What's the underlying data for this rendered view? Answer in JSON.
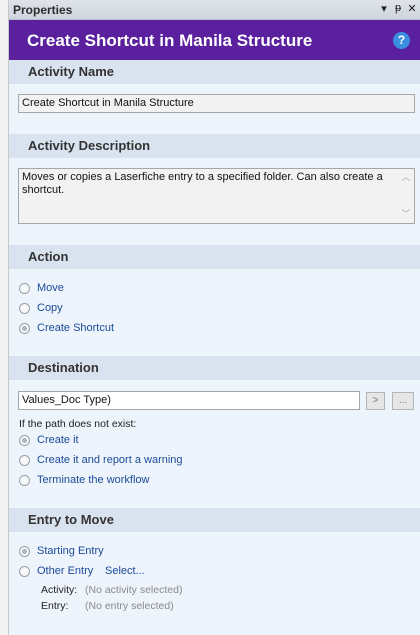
{
  "window": {
    "title": "Properties",
    "ctrl_dropdown": "▾",
    "ctrl_pin": "ᵽ",
    "ctrl_close": "✕"
  },
  "header": {
    "title": "Create Shortcut in Manila Structure",
    "help": "?"
  },
  "activity_name": {
    "heading": "Activity Name",
    "value": "Create Shortcut in Manila Structure"
  },
  "activity_description": {
    "heading": "Activity Description",
    "value": "Moves or copies a Laserfiche entry to a specified folder.  Can also create a shortcut."
  },
  "action": {
    "heading": "Action",
    "options": [
      "Move",
      "Copy",
      "Create Shortcut"
    ],
    "selected": "Create Shortcut"
  },
  "destination": {
    "heading": "Destination",
    "path_value": "Values_Doc Type)",
    "browse_label": ">",
    "more_label": "...",
    "if_not_exist_label": "If the path does not exist:",
    "options": [
      "Create it",
      "Create it and report a warning",
      "Terminate the workflow"
    ],
    "selected": "Create it"
  },
  "entry_to_move": {
    "heading": "Entry to Move",
    "options": [
      "Starting Entry",
      "Other Entry"
    ],
    "selected": "Starting Entry",
    "select_link": "Select...",
    "activity_label": "Activity:",
    "activity_value": "(No activity selected)",
    "entry_label": "Entry:",
    "entry_value": "(No entry selected)"
  }
}
